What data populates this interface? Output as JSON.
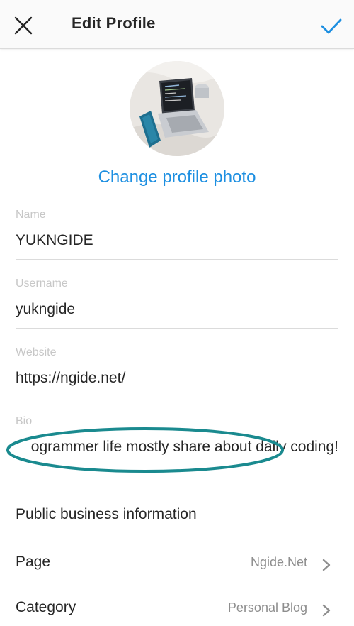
{
  "header": {
    "title": "Edit Profile",
    "close_icon": "close-icon",
    "confirm_icon": "checkmark-icon",
    "accent_color": "#1d8fe1"
  },
  "profile_photo": {
    "change_label": "Change profile photo"
  },
  "fields": {
    "name": {
      "label": "Name",
      "value": "YUKNGIDE"
    },
    "username": {
      "label": "Username",
      "value": "yukngide"
    },
    "website": {
      "label": "Website",
      "value": "https://ngide.net/"
    },
    "bio": {
      "label": "Bio",
      "value": "ogrammer life mostly share about daily coding!"
    }
  },
  "business": {
    "section_title": "Public business information",
    "rows": [
      {
        "label": "Page",
        "value": "Ngide.Net"
      },
      {
        "label": "Category",
        "value": "Personal Blog"
      }
    ]
  }
}
